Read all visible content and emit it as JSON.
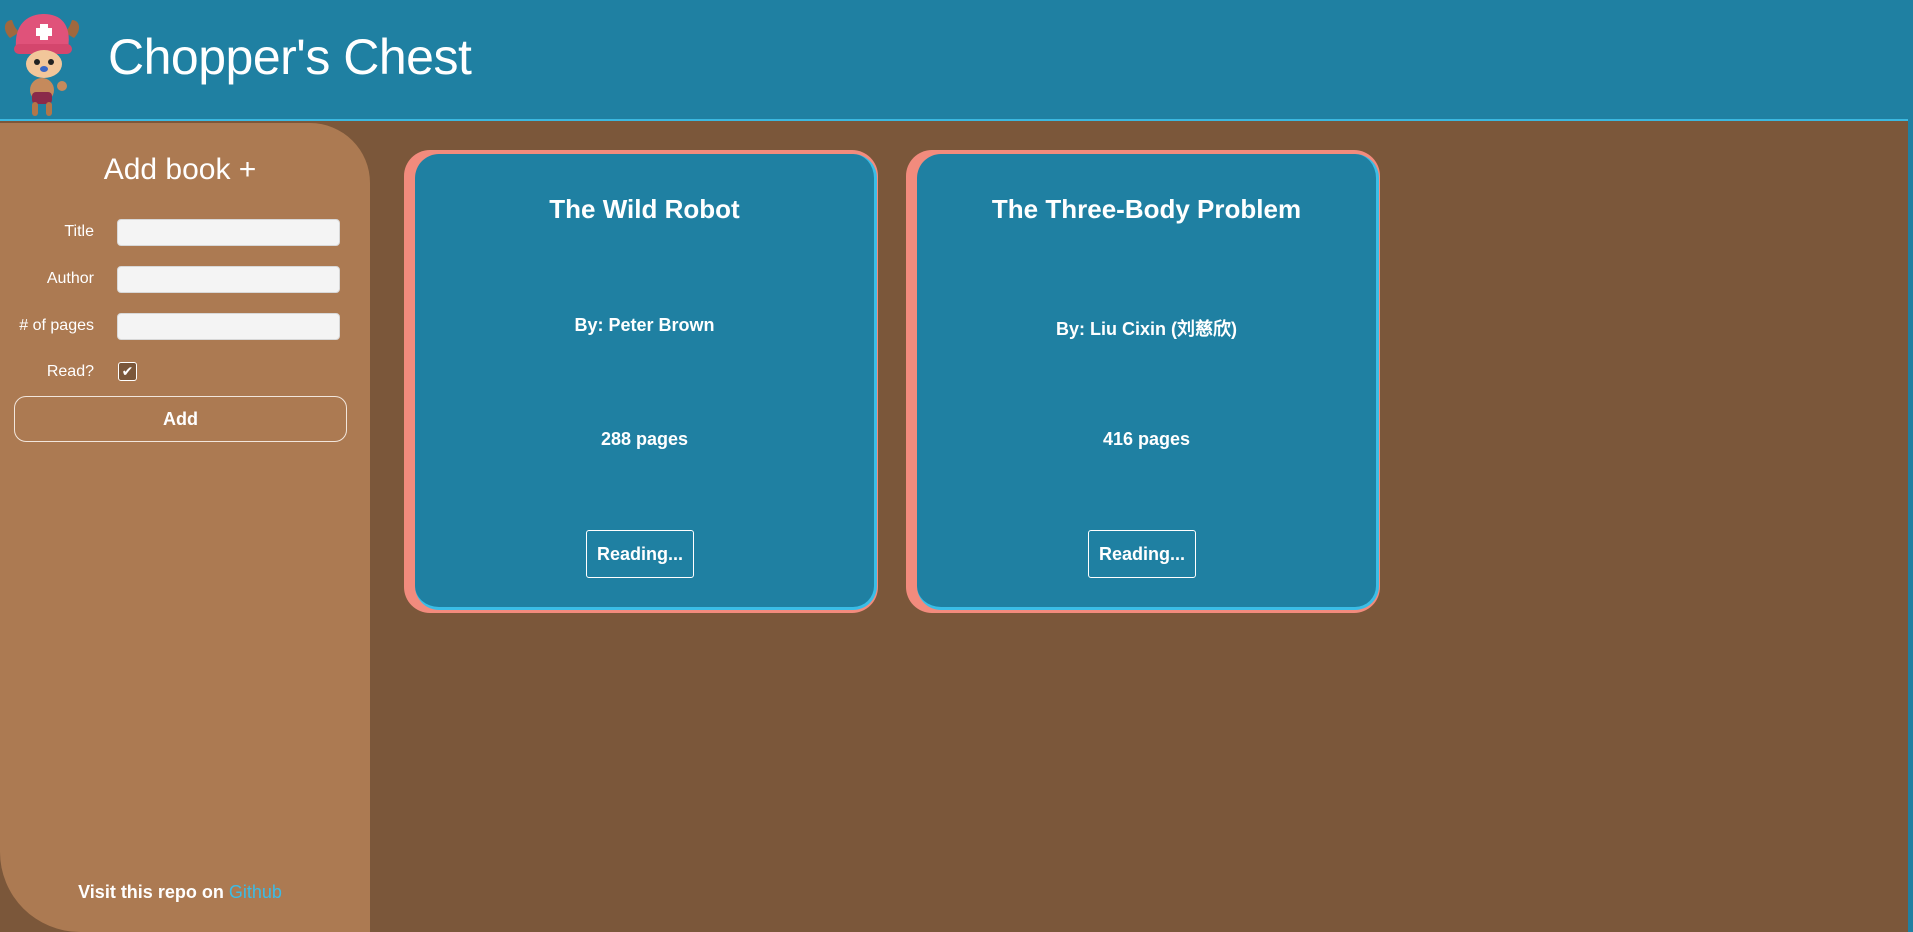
{
  "header": {
    "title": "Chopper's Chest",
    "logo_icon": "chopper-character-icon"
  },
  "sidebar": {
    "heading": "Add book +",
    "fields": [
      {
        "label": "Title",
        "value": ""
      },
      {
        "label": "Author",
        "value": ""
      },
      {
        "label": "# of pages",
        "value": ""
      }
    ],
    "read_label": "Read?",
    "read_checked": true,
    "add_button": "Add",
    "footer_text": "Visit this repo on ",
    "footer_link": "Github"
  },
  "books": [
    {
      "title": "The Wild Robot",
      "author": "By: Peter Brown",
      "pages": "288 pages",
      "status": "Reading..."
    },
    {
      "title": "The Three-Body Problem",
      "author": "By: Liu Cixin (刘慈欣)",
      "pages": "416 pages",
      "status": "Reading..."
    }
  ],
  "colors": {
    "header_bg": "#1f80a2",
    "page_bg": "#7b573a",
    "sidebar_bg": "#ac7a52",
    "card_accent": "#f28b7d",
    "link": "#3bbce6"
  }
}
